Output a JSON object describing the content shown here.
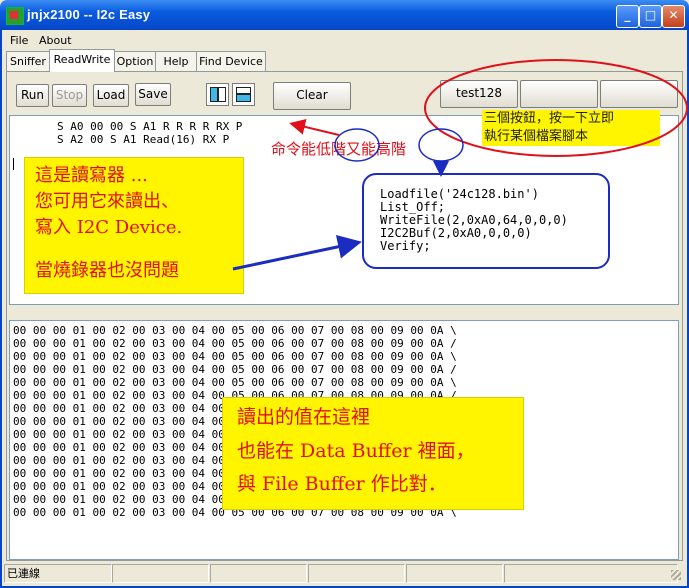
{
  "window": {
    "title": "jnjx2100 -- I2c Easy",
    "minimize": "_",
    "maximize": "□",
    "close": "✕"
  },
  "menu": [
    "File",
    "About"
  ],
  "tabs": [
    "Sniffer",
    "ReadWrite",
    "Option",
    "Help",
    "Find Device"
  ],
  "toolbar": {
    "run": "Run",
    "stop": "Stop",
    "load": "Load",
    "save": "Save",
    "clear": "Clear",
    "script_buttons": [
      "test128",
      "",
      ""
    ]
  },
  "commands": [
    "S A0 00 00 S A1 R R R R RX P",
    "S A2 00 S A1 Read(16) RX P"
  ],
  "hex_rows": [
    "00 00 00 01 00 02 00 03 00 04 00 05 00 06 00 07 00 08 00 09 00 0A \\",
    "00 00 00 01 00 02 00 03 00 04 00 05 00 06 00 07 00 08 00 09 00 0A /",
    "00 00 00 01 00 02 00 03 00 04 00 05 00 06 00 07 00 08 00 09 00 0A \\",
    "00 00 00 01 00 02 00 03 00 04 00 05 00 06 00 07 00 08 00 09 00 0A /",
    "00 00 00 01 00 02 00 03 00 04 00 05 00 06 00 07 00 08 00 09 00 0A \\",
    "00 00 00 01 00 02 00 03 00 04 00 05 00 06 00 07 00 08 00 09 00 0A /",
    "00 00 00 01 00 02 00 03 00 04 00 05 00 06 00 07 00 08 00 09 00 0A \\",
    "00 00 00 01 00 02 00 03 00 04 00 05 00 06 00 07 00 08 00 09 00 0A /",
    "00 00 00 01 00 02 00 03 00 04 00 05 00 06 00 07 00 08 00 09 00 0A \\",
    "00 00 00 01 00 02 00 03 00 04 00 05 00 06 00 07 00 08 00 09 00 0A /",
    "00 00 00 01 00 02 00 03 00 04 00 05 00 06 00 07 00 08 00 09 00 0A \\",
    "00 00 00 01 00 02 00 03 00 04 00 05 00 06 00 07 00 08 00 09 00 0A /",
    "00 00 00 01 00 02 00 03 00 04 00 05 00 06 00 07 00 08 00 09 00 0A \\",
    "00 00 00 01 00 02 00 03 00 04 00 05 00 06 00 07 00 08 00 09 00 0A /",
    "00 00 00 01 00 02 00 03 00 04 00 05 00 06 00 07 00 08 00 09 00 0A \\"
  ],
  "annotations": {
    "script_buttons_note": [
      "三個按鈕，按一下立即",
      "執行某個檔案腳本"
    ],
    "command_level_note": {
      "a": "命令能",
      "b": "低階",
      "c": "又能",
      "d": "高階"
    },
    "read_write_note": [
      "這是讀寫器 ...",
      "您可用它來讀出、",
      "寫入 I2C Device.",
      "當燒錄器也沒問題"
    ],
    "script_example": [
      "Loadfile('24c128.bin')",
      "List_Off;",
      "WriteFile(2,0xA0,64,0,0,0)",
      "I2C2Buf(2,0xA0,0,0,0)",
      "Verify;"
    ],
    "buffer_note": [
      "讀出的值在這裡",
      "也能在 Data Buffer 裡面，",
      "與 File Buffer 作比對．"
    ]
  },
  "status": {
    "connection": "已連線",
    "cells": [
      "",
      "",
      "",
      "",
      ""
    ]
  },
  "colors": {
    "annotation_red": "#e0101a",
    "annotation_yellow": "#fff500",
    "annotation_blue": "#1b2cc0",
    "titlebar_blue": "#0a5ce0"
  }
}
